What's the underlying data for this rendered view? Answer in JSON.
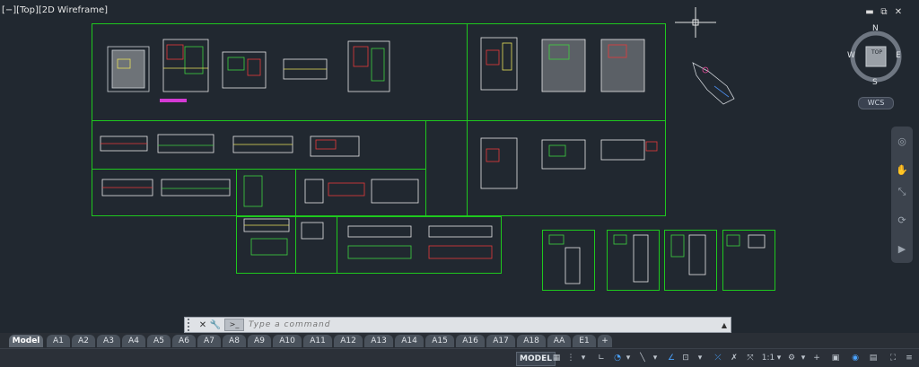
{
  "viewport": {
    "label": "[−][Top][2D Wireframe]",
    "window_controls": [
      "▬",
      "⧉",
      "✕"
    ],
    "navcube": {
      "top": "TOP",
      "north": "N",
      "south": "S",
      "east": "E",
      "west": "W"
    },
    "wcs": "WCS",
    "accent_sheet_color": "#1ec81e"
  },
  "command": {
    "placeholder": "Type a command",
    "prompt_icon": ">_",
    "close_icon": "✕",
    "settings_icon": "🔧",
    "history_icon": "▲"
  },
  "tabs": [
    "Model",
    "A1",
    "A2",
    "A3",
    "A4",
    "A5",
    "A6",
    "A7",
    "A8",
    "A9",
    "A10",
    "A11",
    "A12",
    "A13",
    "A14",
    "A15",
    "A16",
    "A17",
    "A18",
    "AA",
    "E1",
    "+"
  ],
  "statusbar": {
    "model_label": "MODEL",
    "scale_label": "1:1",
    "icons": [
      "grid-icon",
      "snap-icon",
      "ortho-icon",
      "polar-icon",
      "isodraft-icon",
      "osnap-icon",
      "otrack-icon",
      "lineweight-icon",
      "transparency-icon",
      "selection-cycling-icon",
      "annotation-visibility-icon",
      "autoscale-icon",
      "annotation-scale",
      "workspace-icon",
      "plus-icon",
      "isolate-icon",
      "hardware-accel-icon",
      "clean-screen-icon",
      "customize-icon"
    ]
  }
}
